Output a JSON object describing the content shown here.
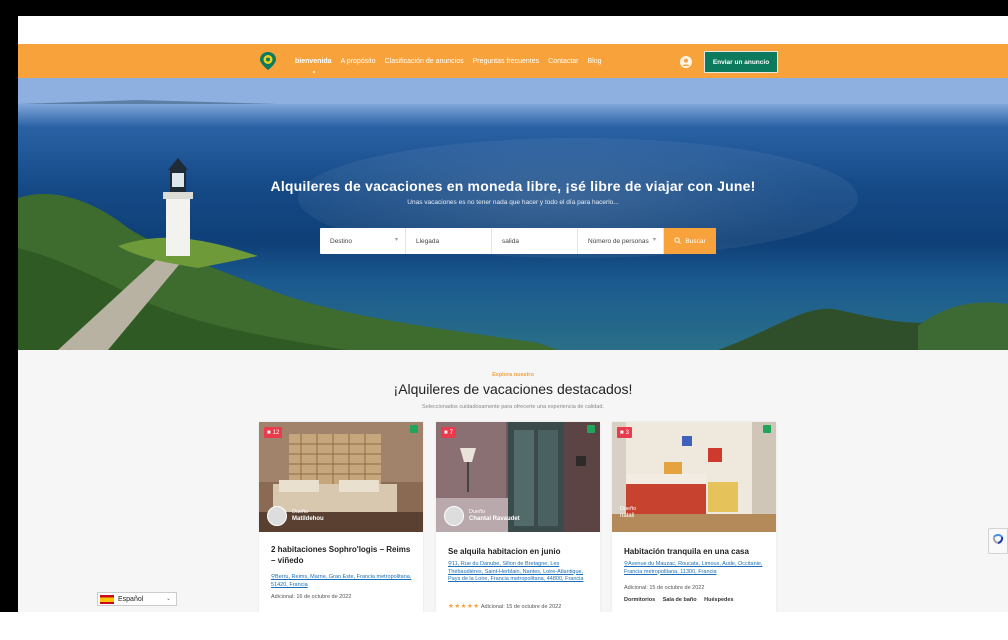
{
  "nav": {
    "links": [
      {
        "label": "bienvenida"
      },
      {
        "label": "A propósito"
      },
      {
        "label": "Clasificación de anuncios"
      },
      {
        "label": "Preguntas frecuentes"
      },
      {
        "label": "Contactar"
      },
      {
        "label": "Blog"
      }
    ],
    "post_button": "Enviar un anuncio"
  },
  "hero": {
    "title": "Alquileres de vacaciones en moneda libre, ¡sé libre de viajar con June!",
    "subtitle": "Unas vacaciones es no tener nada que hacer y todo el día para hacerlo..."
  },
  "search": {
    "destination": "Destino",
    "arrival": "Llegada",
    "departure": "salida",
    "guests": "Número de personas",
    "button": "Buscar"
  },
  "section": {
    "kicker": "Explora nuestro",
    "title": "¡Alquileres de vacaciones destacados!",
    "subtitle": "Seleccionados cuidadosamente para ofrecerte una experiencia de calidad."
  },
  "cards": [
    {
      "photos": "12",
      "owner_role": "Dueño",
      "owner_name": "Matildehou",
      "title": "2 habitaciones Sophro'logis – Reims – viñedo",
      "address": "Berru, Reims, Marne, Gran Este, Francia metropolitana, 51420, Francia",
      "date": "Adicional: 16 de octubre de 2022"
    },
    {
      "photos": "7",
      "owner_role": "Dueño",
      "owner_name": "Chantal Ravaudet",
      "title": "Se alquila habitacion en junio",
      "address": "11, Rue du Danube, Sillon de Bretagne, Les Thébaudières, Saint-Herblain, Nantes, Loire-Atlantique, Pays de la Loire, Francia metropolitana, 44800, Francia",
      "date": "Adicional: 15 de octubre de 2022"
    },
    {
      "photos": "3",
      "owner_role": "Dueño",
      "owner_name": "natali",
      "title": "Habitación tranquila en una casa",
      "address": "Avenue du Mauzac, Roucata, Limoux, Aude, Occitanie, Francia metropolitana, 11300, Francia",
      "date": "Adicional: 15 de octubre de 2022",
      "features": [
        "Dormitorios",
        "Sala de baño",
        "Huéspedes"
      ]
    }
  ],
  "language": "Español",
  "colors": {
    "accent": "#f7a23a",
    "button_green": "#0b7a5d",
    "link_blue": "#1a6fb8",
    "badge_red": "#e83b4e"
  }
}
